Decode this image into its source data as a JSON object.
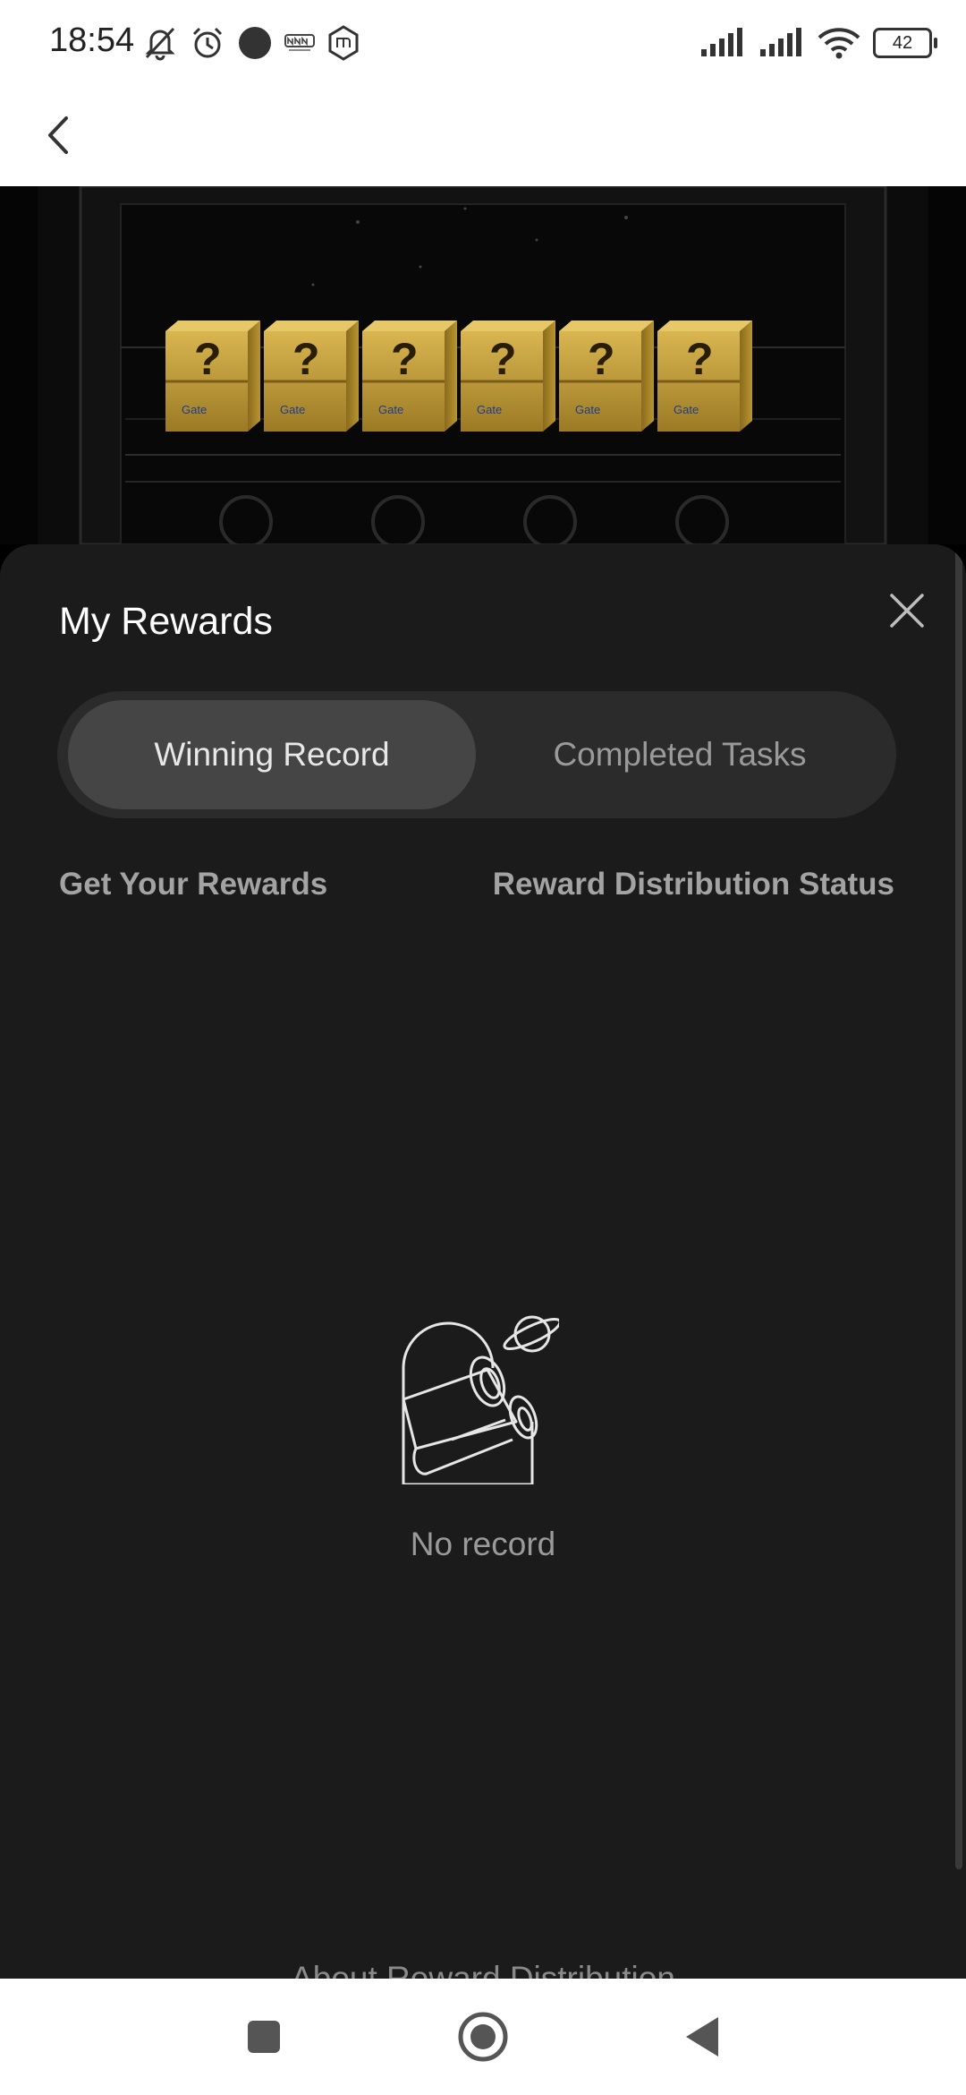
{
  "status_bar": {
    "time": "18:54",
    "battery": "42",
    "icons_left": [
      "mute-bell-icon",
      "alarm-icon",
      "record-dot-icon",
      "cnn-indonesia-icon",
      "mi-icon"
    ],
    "icons_right": [
      "signal-icon",
      "signal-icon",
      "wifi-icon",
      "battery-icon"
    ]
  },
  "header": {
    "back_icon": "chevron-left-icon"
  },
  "banner": {
    "box_logo_text": "Gate",
    "box_count": 6
  },
  "sheet": {
    "title": "My Rewards",
    "tabs": [
      {
        "label": "Winning Record",
        "active": true
      },
      {
        "label": "Completed Tasks",
        "active": false
      }
    ],
    "columns": {
      "left": "Get Your Rewards",
      "right": "Reward Distribution Status"
    },
    "empty_text": "No record",
    "footer_link": "About Reward Distribution"
  },
  "nav_bar": {
    "icons": [
      "recent-apps-icon",
      "home-icon",
      "back-icon"
    ]
  },
  "colors": {
    "sheet_bg": "#1b1b1c",
    "tab_active": "#454546",
    "accent_box": "#c9a43a"
  }
}
